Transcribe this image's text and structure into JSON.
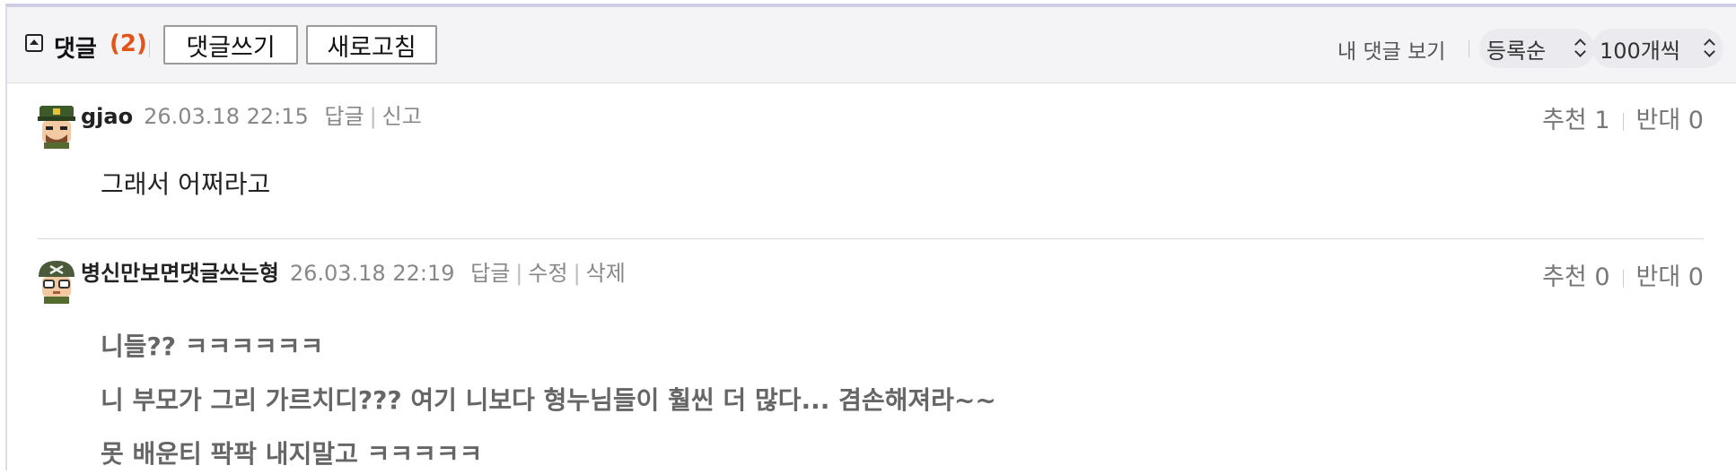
{
  "toolbar": {
    "title": "댓글",
    "count": "(2)",
    "write_button": "댓글쓰기",
    "refresh_button": "새로고침",
    "my_comments_link": "내 댓글 보기",
    "sort_select": "등록순",
    "per_page_select": "100개씩"
  },
  "comments": [
    {
      "author": "gjao",
      "datetime": "26.03.18 22:15",
      "actions": [
        "답글",
        "신고"
      ],
      "upvote": "추천 1",
      "downvote": "반대 0",
      "lines": [
        "그래서 어쩌라고"
      ],
      "avatar_icon": "soldier-avatar-icon"
    },
    {
      "author": "병신만보면댓글쓰는형",
      "datetime": "26.03.18 22:19",
      "actions": [
        "답글",
        "수정",
        "삭제"
      ],
      "upvote": "추천 0",
      "downvote": "반대 0",
      "lines": [
        "니들?? ㅋㅋㅋㅋㅋㅋ",
        "니 부모가 그리 가르치디??? 여기 니보다 형누님들이 훨씬 더 많다... 겸손해져라~~",
        "못 배운티 팍팍 내지말고 ㅋㅋㅋㅋㅋ"
      ],
      "avatar_icon": "helmet-soldier-avatar-icon"
    }
  ],
  "colors": {
    "accent_count": "#e2541a",
    "toolbar_bg": "#f4f4f6",
    "frame_border": "#cfcde4"
  }
}
